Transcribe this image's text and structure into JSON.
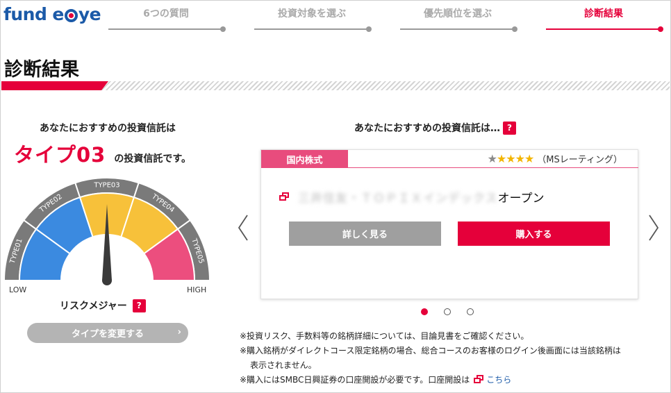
{
  "header": {
    "logo_left": "fund",
    "logo_e": "e",
    "logo_right": "ye",
    "steps": [
      {
        "label": "6つの質問"
      },
      {
        "label": "投資対象を選ぶ"
      },
      {
        "label": "優先順位を選ぶ"
      },
      {
        "label": "診断結果"
      }
    ],
    "active_step": 3
  },
  "page_title": "診断結果",
  "left": {
    "heading": "あなたにおすすめの投資信託は",
    "type_label": "タイプ03",
    "type_suffix": "の投資信託です。",
    "gauge": {
      "segments": [
        "TYPE01",
        "TYPE02",
        "TYPE03",
        "TYPE04",
        "TYPE05"
      ],
      "low_label": "LOW",
      "high_label": "HIGH",
      "current_type": 3
    },
    "risk_measure_label": "リスクメジャー",
    "help_badge": "?",
    "change_type_button": "タイプを変更する",
    "change_type_chevron": "›"
  },
  "right": {
    "heading": "あなたにおすすめの投資信託は…",
    "help_badge": "?",
    "card": {
      "category": "国内株式",
      "rating_stars_filled": 4,
      "rating_stars_total": 5,
      "rating_source": "（MSレーティング）",
      "fund_name_redacted": "三井住友・ＴＯＰＩＸインデックス",
      "fund_name_suffix": "オープン",
      "detail_button": "詳しく見る",
      "buy_button": "購入する"
    },
    "pagination": {
      "total": 3,
      "current": 1
    }
  },
  "notes": {
    "line1": "※投資リスク、手数料等の銘柄詳細については、目論見書をご確認ください。",
    "line2": "※購入銘柄がダイレクトコース限定銘柄の場合、総合コースのお客様のログイン後画面には当該銘柄は",
    "line2b": "表示されません。",
    "line3": "※購入にはSMBC日興証券の口座開設が必要です。口座開設は",
    "line3_link": "こちら"
  },
  "colors": {
    "accent": "#e5003a",
    "brand": "#1b5aa8",
    "type01": "#3b8ae0",
    "type02": "#3b8ae0",
    "type03": "#f7c13a",
    "type04": "#f7c13a",
    "type05": "#ec4e7e"
  }
}
